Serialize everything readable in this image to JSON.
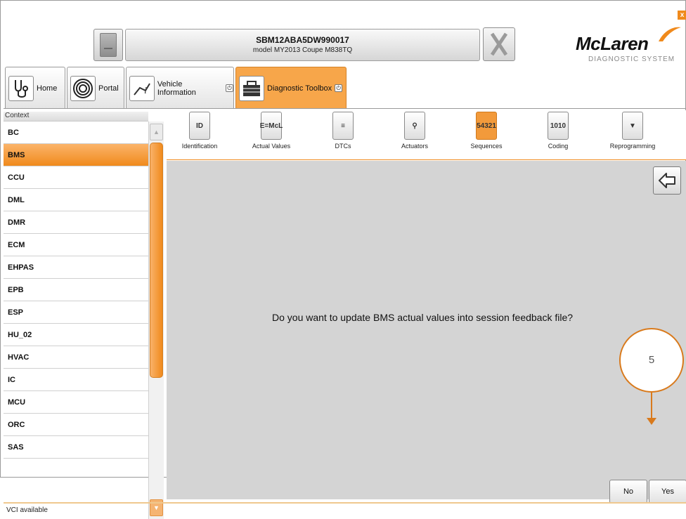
{
  "header": {
    "vin": "SBM12ABA5DW990017",
    "model": "model MY2013 Coupe M838TQ",
    "logo_word": "McLaren",
    "logo_sub": "DIAGNOSTIC SYSTEM",
    "close_label": "x"
  },
  "tabs": [
    {
      "label": "Home",
      "icon": "stethoscope-icon"
    },
    {
      "label": "Portal",
      "icon": "spiral-icon"
    },
    {
      "label": "Vehicle Information",
      "icon": "info-icon"
    },
    {
      "label": "Diagnostic Toolbox",
      "icon": "toolbox-icon"
    }
  ],
  "sidebar": {
    "header": "Context",
    "items": [
      "BC",
      "BMS",
      "CCU",
      "DML",
      "DMR",
      "ECM",
      "EHPAS",
      "EPB",
      "ESP",
      "HU_02",
      "HVAC",
      "IC",
      "MCU",
      "ORC",
      "SAS"
    ],
    "selected": "BMS"
  },
  "toolbar": {
    "items": [
      {
        "label": "Identification",
        "glyph": "ID"
      },
      {
        "label": "Actual Values",
        "glyph": "E=McL"
      },
      {
        "label": "DTCs",
        "glyph": "≡"
      },
      {
        "label": "Actuators",
        "glyph": "⚲"
      },
      {
        "label": "Sequences",
        "glyph": "54321"
      },
      {
        "label": "Coding",
        "glyph": "1010"
      },
      {
        "label": "Reprogramming",
        "glyph": "▼"
      }
    ],
    "active": "Sequences"
  },
  "dialog": {
    "question": "Do you want to update BMS actual values into session feedback file?",
    "no_label": "No",
    "yes_label": "Yes"
  },
  "annotation": {
    "number": "5"
  },
  "status": {
    "text": "VCI available"
  },
  "colors": {
    "accent": "#f08a1c",
    "content_bg": "#d4d4d4"
  }
}
